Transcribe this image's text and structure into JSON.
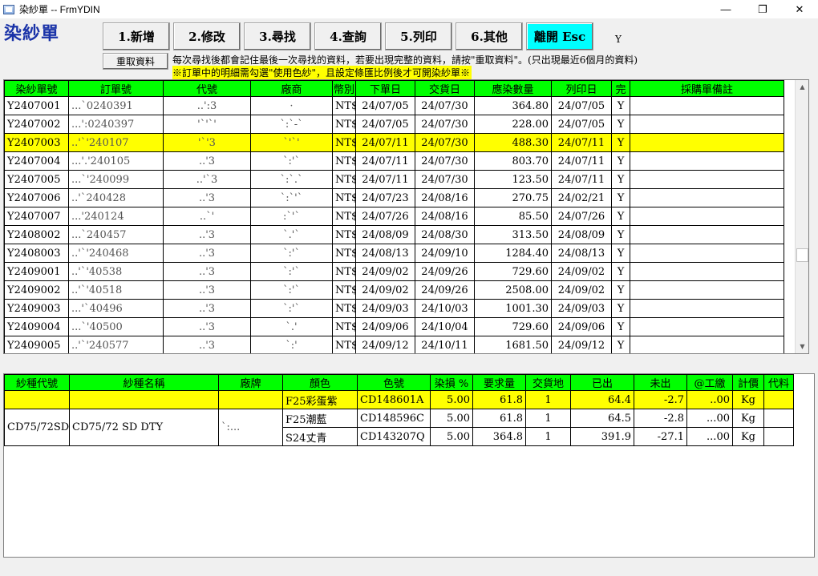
{
  "window": {
    "title": "染紗單 -- FrmYDIN",
    "min": "—",
    "max": "❐",
    "close": "✕"
  },
  "form_title": "染紗單",
  "buttons": {
    "new": "1.新增",
    "edit": "2.修改",
    "find": "3.尋找",
    "query": "4.查詢",
    "print": "5.列印",
    "other": "6.其他",
    "exit": "離開 Esc",
    "reload": "重取資料"
  },
  "y_flag": "Y",
  "notes": {
    "line1": "每次尋找後都會記住最後一次尋找的資料，若要出現完整的資料，請按\"重取資料\"。(只出現最近6個月的資料)",
    "line2": "※訂單中的明細需勾選\"使用色紗\"，且設定條匯比例後才可開染紗單※"
  },
  "orders": {
    "headers": [
      "染紗單號",
      "訂單號",
      "代號",
      "廠商",
      "幣別",
      "下單日",
      "交貨日",
      "應染數量",
      "列印日",
      "完",
      "採購單備註"
    ],
    "selected_index": 2,
    "rows": [
      [
        "Y2407001",
        "...`0240391",
        "..':3",
        "·",
        "NT$",
        "24/07/05",
        "24/07/30",
        "364.80",
        "24/07/05",
        "Y",
        ""
      ],
      [
        "Y2407002",
        "...':0240397",
        "'`'`'",
        "`:`-`",
        "NT$",
        "24/07/05",
        "24/07/30",
        "228.00",
        "24/07/05",
        "Y",
        ""
      ],
      [
        "Y2407003",
        "..'`'240107",
        "'`'3",
        "`'`'",
        "NT$",
        "24/07/11",
        "24/07/30",
        "488.30",
        "24/07/11",
        "Y",
        ""
      ],
      [
        "Y2407004",
        "...'.'240105",
        "..'3",
        "`:'`",
        "NT$",
        "24/07/11",
        "24/07/30",
        "803.70",
        "24/07/11",
        "Y",
        ""
      ],
      [
        "Y2407005",
        "...`'240099",
        "..'`3",
        "`:`.`",
        "NT$",
        "24/07/11",
        "24/07/30",
        "123.50",
        "24/07/11",
        "Y",
        ""
      ],
      [
        "Y2407006",
        "..'`240428",
        "..'3",
        "`:`'`",
        "NT$",
        "24/07/23",
        "24/08/16",
        "270.75",
        "24/02/21",
        "Y",
        ""
      ],
      [
        "Y2407007",
        "...'240124",
        "..`'",
        ":`'`",
        "NT$",
        "24/07/26",
        "24/08/16",
        "85.50",
        "24/07/26",
        "Y",
        ""
      ],
      [
        "Y2408002",
        "...`240457",
        "..'3",
        "`.'`",
        "NT$",
        "24/08/09",
        "24/08/30",
        "313.50",
        "24/08/09",
        "Y",
        ""
      ],
      [
        "Y2408003",
        "..'`'240468",
        "..'3",
        "`:'`",
        "NT$",
        "24/08/13",
        "24/09/10",
        "1284.40",
        "24/08/13",
        "Y",
        ""
      ],
      [
        "Y2409001",
        "..'`'40538",
        "..'3",
        "`:'`",
        "NT$",
        "24/09/02",
        "24/09/26",
        "729.60",
        "24/09/02",
        "Y",
        ""
      ],
      [
        "Y2409002",
        "..'`'40518",
        "..'3",
        "`:'`",
        "NT$",
        "24/09/02",
        "24/09/26",
        "2508.00",
        "24/09/02",
        "Y",
        ""
      ],
      [
        "Y2409003",
        "...'`40496",
        "..'3",
        "`:'`",
        "NT$",
        "24/09/03",
        "24/10/03",
        "1001.30",
        "24/09/03",
        "Y",
        ""
      ],
      [
        "Y2409004",
        "...`'40500",
        "..'3",
        "`.'",
        "NT$",
        "24/09/06",
        "24/10/04",
        "729.60",
        "24/09/06",
        "Y",
        ""
      ],
      [
        "Y2409005",
        "..'`'240577",
        "..'3",
        "`:'",
        "NT$",
        "24/09/12",
        "24/10/11",
        "1681.50",
        "24/09/12",
        "Y",
        ""
      ]
    ]
  },
  "details": {
    "headers": [
      "紗種代號",
      "紗種名稱",
      "廠牌",
      "顏色",
      "色號",
      "染損 %",
      "要求量",
      "交貨地",
      "已出",
      "未出",
      "@工繳",
      "計價",
      "代料"
    ],
    "yarn_code": "CD75/72SD",
    "yarn_name": "CD75/72 SD DTY",
    "brand": "`:...",
    "rows": [
      [
        "F25彩蛋紫",
        "CD148601A",
        "5.00",
        "61.8",
        "1",
        "64.4",
        "-2.7",
        "..00",
        "Kg",
        ""
      ],
      [
        "F25潮藍",
        "CD148596C",
        "5.00",
        "61.8",
        "1",
        "64.5",
        "-2.8",
        "...00",
        "Kg",
        ""
      ],
      [
        "S24丈青",
        "CD143207Q",
        "5.00",
        "364.8",
        "1",
        "391.9",
        "-27.1",
        "...00",
        "Kg",
        ""
      ]
    ]
  }
}
